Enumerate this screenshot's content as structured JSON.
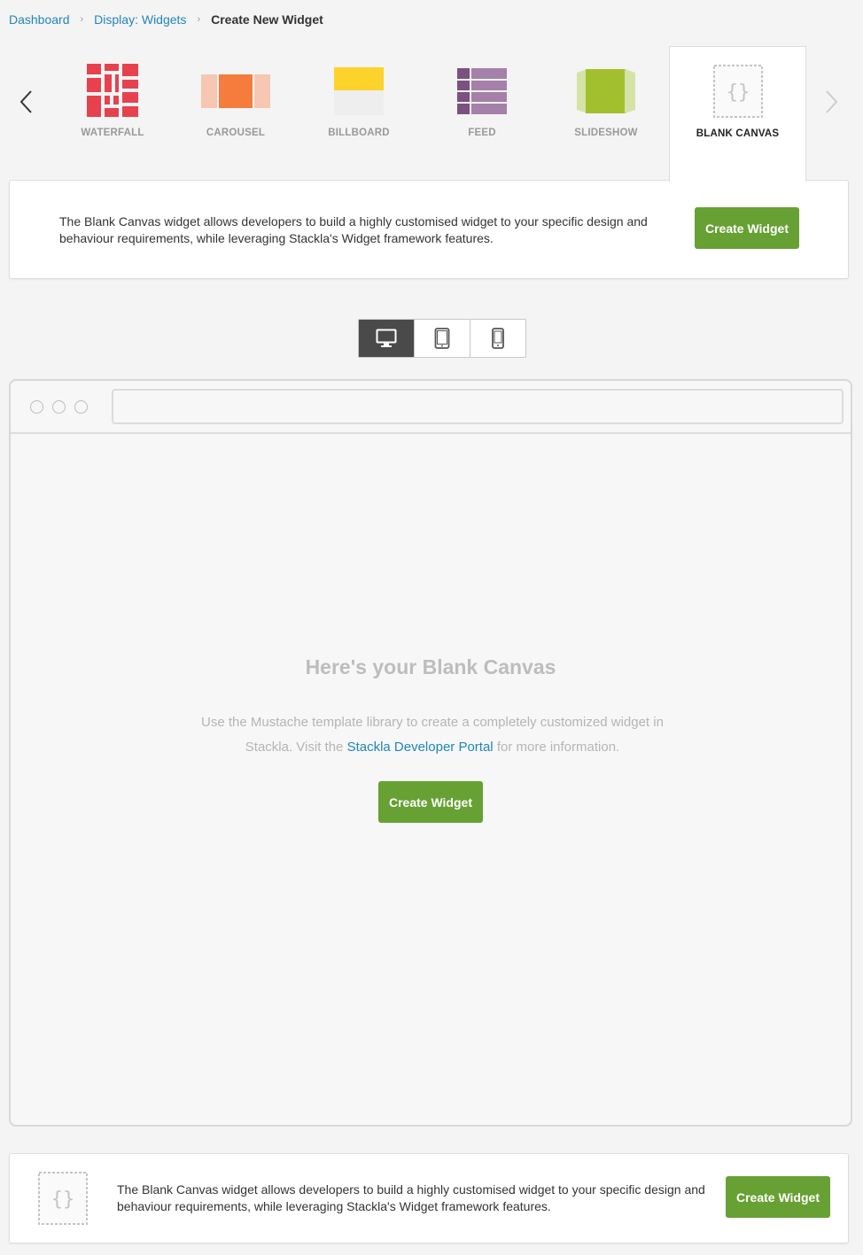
{
  "breadcrumb": {
    "items": [
      "Dashboard",
      "Display: Widgets"
    ],
    "current": "Create New Widget"
  },
  "widget_types": {
    "active": "blank-canvas",
    "items": [
      {
        "id": "waterfall",
        "label": "WATERFALL"
      },
      {
        "id": "carousel",
        "label": "CAROUSEL"
      },
      {
        "id": "billboard",
        "label": "BILLBOARD"
      },
      {
        "id": "feed",
        "label": "FEED"
      },
      {
        "id": "slideshow",
        "label": "SLIDESHOW"
      },
      {
        "id": "blank-canvas",
        "label": "BLANK CANVAS"
      }
    ],
    "icons": {
      "prev": "chevron-left-icon",
      "next": "chevron-right-icon"
    }
  },
  "info_card": {
    "description": "The Blank Canvas widget allows developers to build a highly customised widget to your specific design and behaviour requirements, while leveraging Stackla's Widget framework features.",
    "button_label": "Create Widget"
  },
  "device_toggle": {
    "active": "desktop",
    "options": [
      "desktop-icon",
      "tablet-icon",
      "mobile-icon"
    ]
  },
  "canvas": {
    "title": "Here's your Blank Canvas",
    "desc_before": "Use the Mustache template library to create a completely customized widget in Stackla. Visit the ",
    "link_text": "Stackla Developer Portal",
    "desc_after": " for more information.",
    "button_label": "Create Widget"
  },
  "footer": {
    "description": "The Blank Canvas widget allows developers to build a highly customised widget to your specific design and behaviour requirements, while leveraging Stackla's Widget framework features.",
    "button_label": "Create Widget"
  },
  "colors": {
    "accent_green": "#67a033",
    "link_blue": "#1f86b9",
    "waterfall_red": "#e8414e",
    "carousel_orange": "#f57c3c",
    "billboard_yellow": "#fdd22b",
    "feed_purple": "#8b5f8f",
    "slideshow_green": "#a2c02d"
  }
}
